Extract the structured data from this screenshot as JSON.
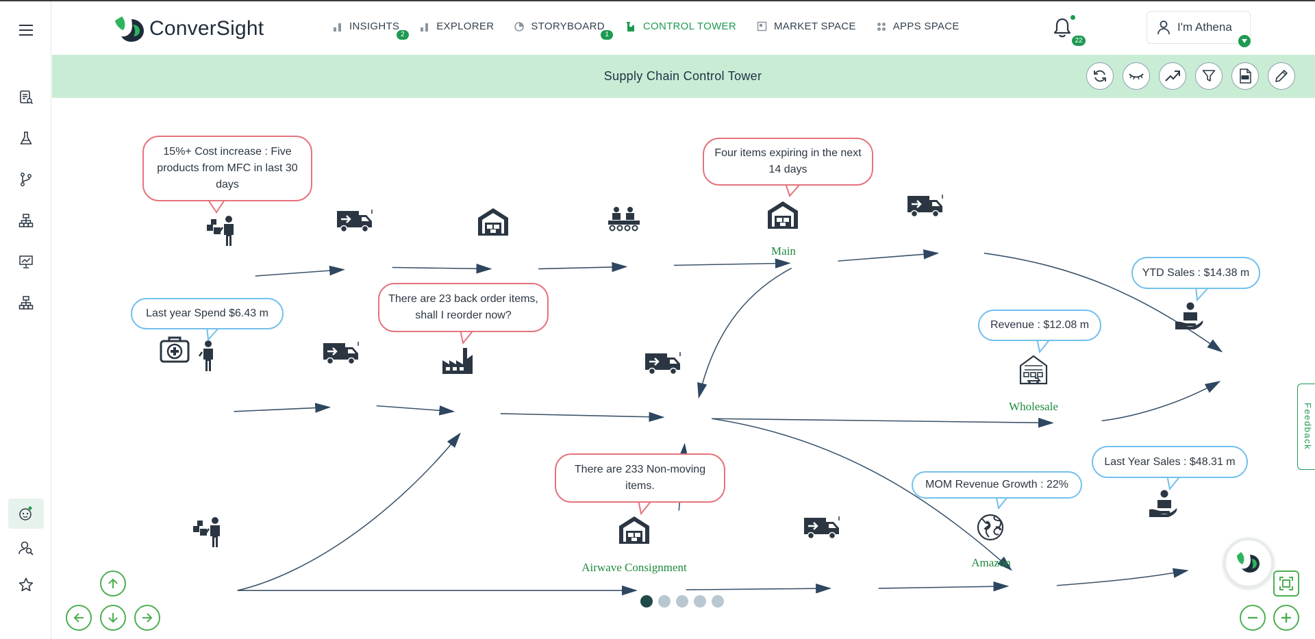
{
  "app": {
    "name": "ConverSight"
  },
  "nav": [
    {
      "label": "INSIGHTS",
      "badge": "2",
      "active": false
    },
    {
      "label": "EXPLORER",
      "badge": "",
      "active": false
    },
    {
      "label": "STORYBOARD",
      "badge": "1",
      "active": false
    },
    {
      "label": "CONTROL TOWER",
      "badge": "",
      "active": true
    },
    {
      "label": "MARKET SPACE",
      "badge": "",
      "active": false
    },
    {
      "label": "APPS SPACE",
      "badge": "",
      "active": false
    }
  ],
  "notifications": {
    "count": "22"
  },
  "user": {
    "label": "I'm Athena"
  },
  "page": {
    "title": "Supply Chain Control Tower"
  },
  "bubbles": {
    "cost_increase": "15%+ Cost increase : Five products from MFC in last 30 days",
    "expiring": "Four items expiring in the next 14 days",
    "last_year_spend": "Last year Spend $6.43 m",
    "back_order": "There are 23 back order items, shall I reorder now?",
    "ytd_sales": "YTD Sales : $14.38 m",
    "revenue": "Revenue : $12.08 m",
    "non_moving": "There are 233 Non-moving items.",
    "mom_growth": "MOM Revenue Growth : 22%",
    "last_year_sales": "Last Year Sales : $48.31 m"
  },
  "node_labels": {
    "main": "Main",
    "wholesale": "Wholesale",
    "airwave": "Airwave Consignment",
    "amazon": "Amazon"
  },
  "feedback": {
    "label": "Feedback"
  },
  "pagination": {
    "total": 5,
    "active": 1
  },
  "colors": {
    "brand": "#1d9a52",
    "title_bar": "#c9ecd5",
    "red_callout": "#e5737d",
    "blue_callout": "#72c0ec",
    "edge": "#3a5268",
    "icon": "#2b3642",
    "node_label": "#1d8a3e"
  }
}
